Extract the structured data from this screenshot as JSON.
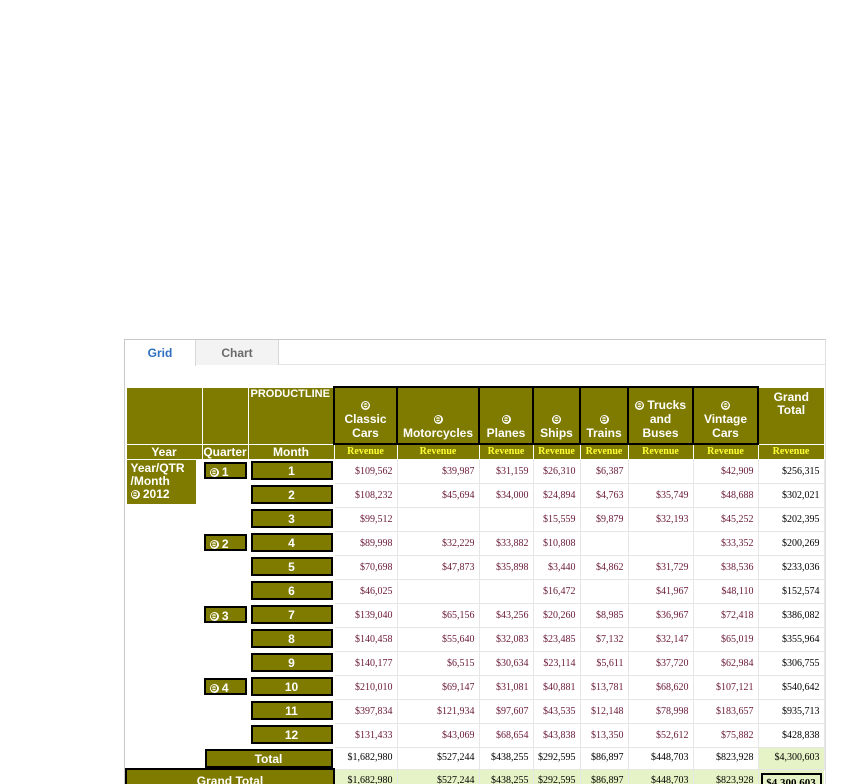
{
  "tabs": {
    "grid": "Grid",
    "chart": "Chart"
  },
  "pivot": {
    "productline_label": "PRODUCTLINE",
    "columns": [
      {
        "name_lines": [
          "Classic",
          "Cars"
        ],
        "measure": "Revenue"
      },
      {
        "name_lines": [
          "Motorcycles"
        ],
        "measure": "Revenue"
      },
      {
        "name_lines": [
          "Planes"
        ],
        "measure": "Revenue"
      },
      {
        "name_lines": [
          "Ships"
        ],
        "measure": "Revenue"
      },
      {
        "name_lines": [
          "Trains"
        ],
        "measure": "Revenue"
      },
      {
        "name_lines": [
          "Trucks",
          "and",
          "Buses"
        ],
        "measure": "Revenue"
      },
      {
        "name_lines": [
          "Vintage",
          "Cars"
        ],
        "measure": "Revenue"
      }
    ],
    "grand_total_header_lines": [
      "Grand",
      "Total"
    ],
    "grand_total_measure": "Revenue",
    "row_headers": {
      "year": "Year",
      "quarter": "Quarter",
      "month": "Month"
    },
    "year_label_lines": [
      "Year/QTR",
      "/Month"
    ],
    "year_value": "2012",
    "collapse_glyph": "⊖",
    "quarters": [
      {
        "label": "1",
        "months": [
          {
            "month": "1",
            "values": [
              "$109,562",
              "$39,987",
              "$31,159",
              "$26,310",
              "$6,387",
              "",
              "$42,909"
            ],
            "total": "$256,315"
          },
          {
            "month": "2",
            "values": [
              "$108,232",
              "$45,694",
              "$34,000",
              "$24,894",
              "$4,763",
              "$35,749",
              "$48,688"
            ],
            "total": "$302,021"
          },
          {
            "month": "3",
            "values": [
              "$99,512",
              "",
              "",
              "$15,559",
              "$9,879",
              "$32,193",
              "$45,252"
            ],
            "total": "$202,395"
          }
        ]
      },
      {
        "label": "2",
        "months": [
          {
            "month": "4",
            "values": [
              "$89,998",
              "$32,229",
              "$33,882",
              "$10,808",
              "",
              "",
              "$33,352"
            ],
            "total": "$200,269"
          },
          {
            "month": "5",
            "values": [
              "$70,698",
              "$47,873",
              "$35,898",
              "$3,440",
              "$4,862",
              "$31,729",
              "$38,536"
            ],
            "total": "$233,036"
          },
          {
            "month": "6",
            "values": [
              "$46,025",
              "",
              "",
              "$16,472",
              "",
              "$41,967",
              "$48,110"
            ],
            "total": "$152,574"
          }
        ]
      },
      {
        "label": "3",
        "months": [
          {
            "month": "7",
            "values": [
              "$139,040",
              "$65,156",
              "$43,256",
              "$20,260",
              "$8,985",
              "$36,967",
              "$72,418"
            ],
            "total": "$386,082"
          },
          {
            "month": "8",
            "values": [
              "$140,458",
              "$55,640",
              "$32,083",
              "$23,485",
              "$7,132",
              "$32,147",
              "$65,019"
            ],
            "total": "$355,964"
          },
          {
            "month": "9",
            "values": [
              "$140,177",
              "$6,515",
              "$30,634",
              "$23,114",
              "$5,611",
              "$37,720",
              "$62,984"
            ],
            "total": "$306,755"
          }
        ]
      },
      {
        "label": "4",
        "months": [
          {
            "month": "10",
            "values": [
              "$210,010",
              "$69,147",
              "$31,081",
              "$40,881",
              "$13,781",
              "$68,620",
              "$107,121"
            ],
            "total": "$540,642"
          },
          {
            "month": "11",
            "values": [
              "$397,834",
              "$121,934",
              "$97,607",
              "$43,535",
              "$12,148",
              "$78,998",
              "$183,657"
            ],
            "total": "$935,713"
          },
          {
            "month": "12",
            "values": [
              "$131,433",
              "$43,069",
              "$68,654",
              "$43,838",
              "$13,350",
              "$52,612",
              "$75,882"
            ],
            "total": "$428,838"
          }
        ]
      }
    ],
    "year_total": {
      "label": "Total",
      "values": [
        "$1,682,980",
        "$527,244",
        "$438,255",
        "$292,595",
        "$86,897",
        "$448,703",
        "$823,928"
      ],
      "total": "$4,300,603"
    },
    "grand_total": {
      "label": "Grand Total",
      "values": [
        "$1,682,980",
        "$527,244",
        "$438,255",
        "$292,595",
        "$86,897",
        "$448,703",
        "$823,928"
      ],
      "total": "$4,300,603"
    }
  }
}
